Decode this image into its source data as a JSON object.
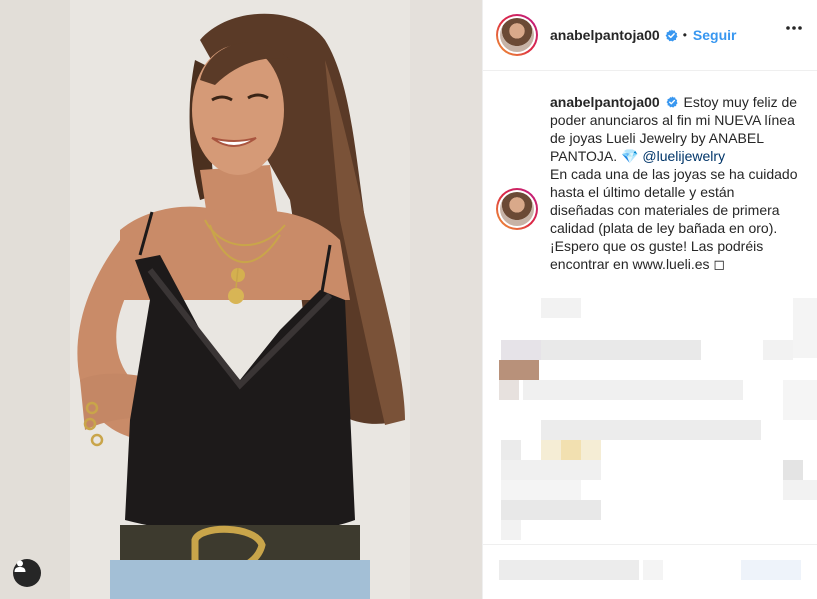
{
  "post": {
    "username": "anabelpantoja00",
    "follow_label": "Seguir",
    "separator": "•",
    "caption": {
      "username": "anabelpantoja00",
      "line1": "Estoy muy feliz de poder anunciaros al fin mi NUEVA línea de joyas Lueli Jewelry by ANABEL PANTOJA.",
      "gem": "💎",
      "mention": "@luelijewelry",
      "line2": "En cada una de las joyas se ha cuidado hasta el último detalle y están diseñadas con materiales de primera calidad (plata de ley bañada en oro).",
      "line3": "¡Espero que os guste! Las podréis encontrar en www.lueli.es",
      "trailing_glyph": "◻"
    }
  },
  "colors": {
    "accent": "#3897f0",
    "text": "#262626",
    "mention": "#003569",
    "border": "#efefef"
  },
  "icons": {
    "verified": "verified-badge-icon",
    "more": "more-options-icon",
    "user_tag": "user-tag-icon"
  }
}
